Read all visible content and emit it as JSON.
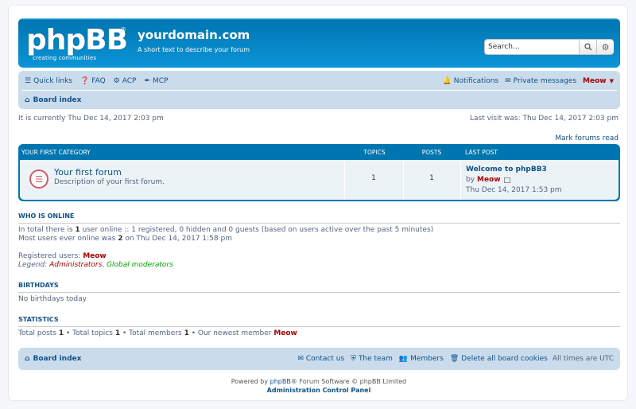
{
  "header": {
    "logo_text": "phpBB",
    "logo_tagline": "creating communities",
    "site_title": "yourdomain.com",
    "site_description": "A short text to describe your forum",
    "search_placeholder": "Search…"
  },
  "nav": {
    "quick_links": "Quick links",
    "faq": "FAQ",
    "acp": "ACP",
    "mcp": "MCP",
    "notifications": "Notifications",
    "private_messages": "Private messages",
    "username": "Meow",
    "board_index": "Board index"
  },
  "times": {
    "current": "It is currently Thu Dec 14, 2017 2:03 pm",
    "last_visit": "Last visit was: Thu Dec 14, 2017 2:03 pm"
  },
  "mark_forums_read": "Mark forums read",
  "category": {
    "title": "Your first category",
    "col_topics": "Topics",
    "col_posts": "Posts",
    "col_last_post": "Last post",
    "forum": {
      "title": "Your first forum",
      "description": "Description of your first forum.",
      "topics": "1",
      "posts": "1",
      "last_post_title": "Welcome to phpBB3",
      "last_post_by": "by",
      "last_post_user": "Meow",
      "last_post_date": "Thu Dec 14, 2017 1:53 pm"
    }
  },
  "who_is_online": {
    "heading": "Who is online",
    "line1_a": "In total there is ",
    "line1_count": "1",
    "line1_b": " user online :: 1 registered, 0 hidden and 0 guests (based on users active over the past 5 minutes)",
    "line2_a": "Most users ever online was ",
    "line2_count": "2",
    "line2_b": " on Thu Dec 14, 2017 1:58 pm",
    "registered_label": "Registered users: ",
    "registered_user": "Meow",
    "legend_label": "Legend: ",
    "legend_admins": "Administrators",
    "legend_sep": ", ",
    "legend_gmods": "Global moderators"
  },
  "birthdays": {
    "heading": "Birthdays",
    "text": "No birthdays today"
  },
  "statistics": {
    "heading": "Statistics",
    "posts_label": "Total posts ",
    "posts": "1",
    "topics_label": " • Total topics ",
    "topics": "1",
    "members_label": " • Total members ",
    "members": "1",
    "newest_label": " • Our newest member ",
    "newest": "Meow"
  },
  "footer": {
    "board_index": "Board index",
    "contact_us": "Contact us",
    "the_team": "The team",
    "members": "Members",
    "delete_cookies": "Delete all board cookies",
    "timezone": "All times are UTC",
    "powered_by_a": "Powered by ",
    "powered_by_link": "phpBB",
    "powered_by_b": "® Forum Software © phpBB Limited",
    "acp_link": "Administration Control Panel"
  },
  "colors": {
    "header_blue": "#12a3eb",
    "nav_bg": "#cadceb",
    "link": "#105289",
    "username_red": "#aa0000",
    "moderator_green": "#00aa00"
  }
}
